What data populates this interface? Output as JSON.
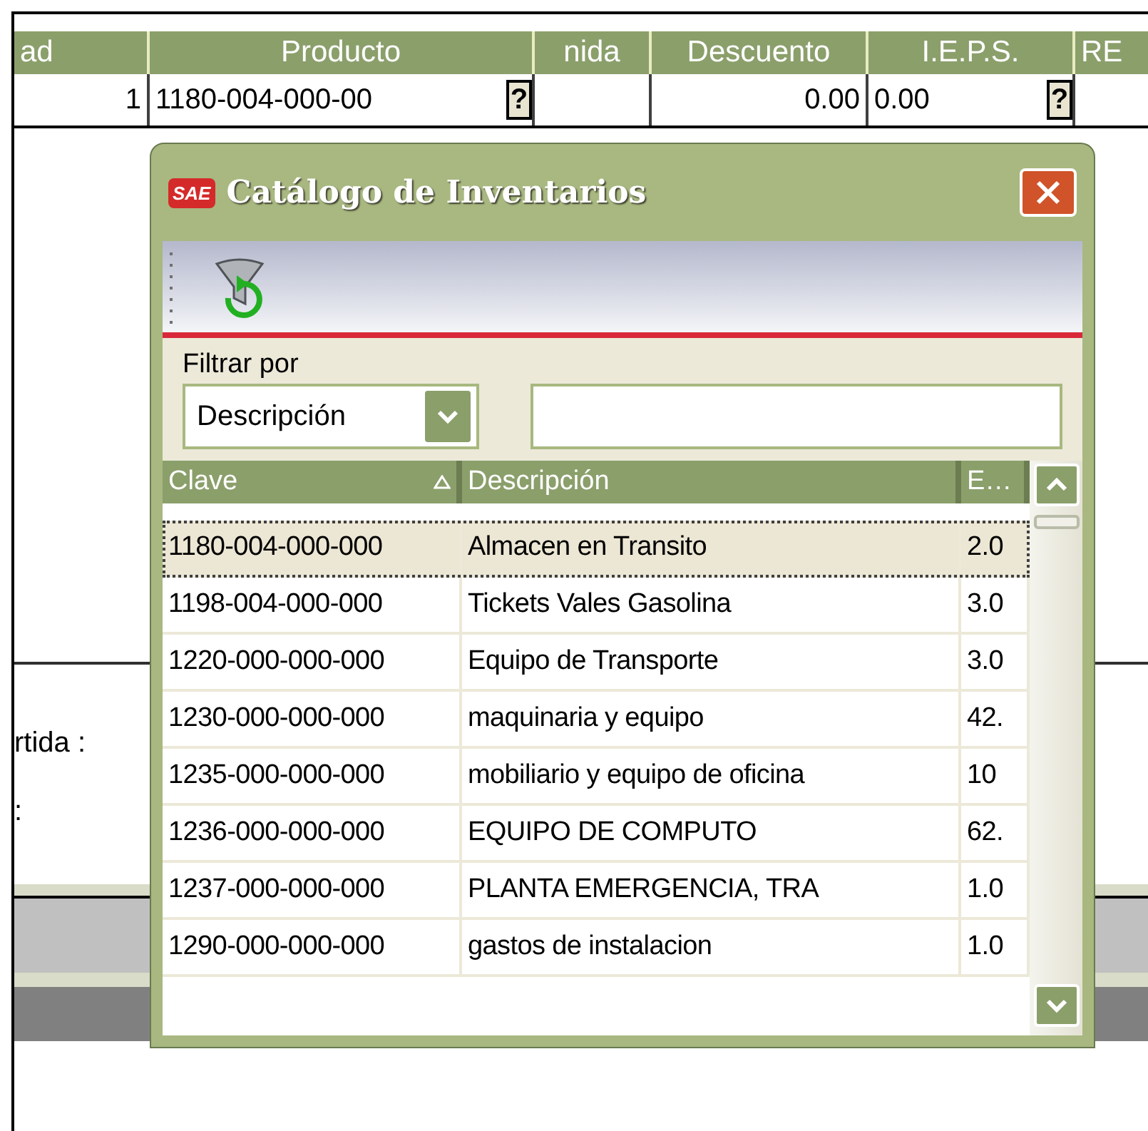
{
  "grid": {
    "columns": [
      {
        "label": "ad"
      },
      {
        "label": "Producto"
      },
      {
        "label": "nida"
      },
      {
        "label": "Descuento"
      },
      {
        "label": "I.E.P.S."
      },
      {
        "label": "RE"
      }
    ],
    "row": [
      {
        "value": "1",
        "lookup": false
      },
      {
        "value": "1180-004-000-00",
        "lookup": true
      },
      {
        "lookup": false
      },
      {
        "value": "0.00",
        "lookup": false
      },
      {
        "value": "0.00",
        "lookup": true
      },
      {
        "lookup": false
      }
    ],
    "lookup_label": "?"
  },
  "labels": [
    "rtida :",
    ":"
  ],
  "dialog": {
    "logo": "SAE",
    "title": "Catálogo de Inventarios",
    "filter_label": "Filtrar por",
    "filter_select": "Descripción",
    "columns": [
      {
        "label": "Clave",
        "sorted": true
      },
      {
        "label": "Descripción",
        "sorted": false
      },
      {
        "label": "E…",
        "sorted": false
      }
    ],
    "rows": [
      {
        "clave": "1180-004-000-000",
        "descripcion": "Almacen en Transito",
        "column_3": "2.0",
        "selected": true
      },
      {
        "clave": "1198-004-000-000",
        "descripcion": "Tickets Vales Gasolina",
        "column_3": "3.0",
        "selected": false
      },
      {
        "clave": "1220-000-000-000",
        "descripcion": "Equipo de Transporte",
        "column_3": "3.0",
        "selected": false
      },
      {
        "clave": "1230-000-000-000",
        "descripcion": "maquinaria y equipo",
        "column_3": "42.",
        "selected": false
      },
      {
        "clave": "1235-000-000-000",
        "descripcion": "mobiliario y equipo de oficina",
        "column_3": "10",
        "selected": false
      },
      {
        "clave": "1236-000-000-000",
        "descripcion": "EQUIPO DE COMPUTO",
        "column_3": "62.",
        "selected": false
      },
      {
        "clave": "1237-000-000-000",
        "descripcion": "PLANTA EMERGENCIA, TRA",
        "column_3": "1.0",
        "selected": false
      },
      {
        "clave": "1290-000-000-000",
        "descripcion": "gastos de instalacion",
        "column_3": "1.0",
        "selected": false
      }
    ]
  }
}
